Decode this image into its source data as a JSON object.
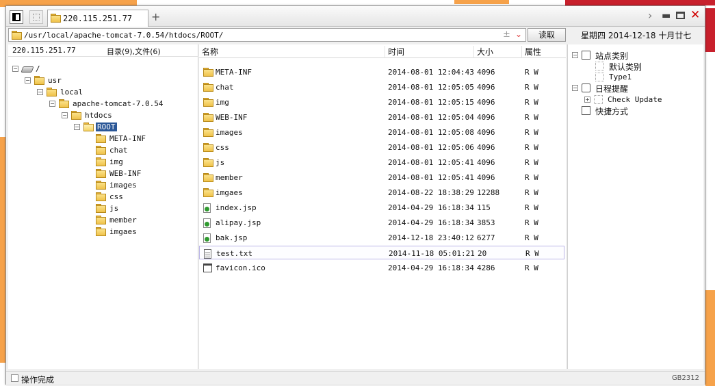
{
  "tab": {
    "host": "220.115.251.77"
  },
  "address": {
    "path": "/usr/local/apache-tomcat-7.0.54/htdocs/ROOT/",
    "read_label": "读取"
  },
  "date_bar": "星期四 2014-12-18 十月廿七",
  "left_panel": {
    "host": "220.115.251.77",
    "counts": "目录(9),文件(6)",
    "tree": [
      {
        "label": "/",
        "depth": 0,
        "expanded": true,
        "icon": "drive-icon"
      },
      {
        "label": "usr",
        "depth": 1,
        "expanded": true,
        "icon": "folder-icon"
      },
      {
        "label": "local",
        "depth": 2,
        "expanded": true,
        "icon": "folder-icon"
      },
      {
        "label": "apache-tomcat-7.0.54",
        "depth": 3,
        "expanded": true,
        "icon": "folder-icon"
      },
      {
        "label": "htdocs",
        "depth": 4,
        "expanded": true,
        "icon": "folder-icon"
      },
      {
        "label": "ROOT",
        "depth": 5,
        "expanded": true,
        "icon": "folder-open-icon",
        "selected": true
      },
      {
        "label": "META-INF",
        "depth": 6,
        "icon": "folder-icon"
      },
      {
        "label": "chat",
        "depth": 6,
        "icon": "folder-icon"
      },
      {
        "label": "img",
        "depth": 6,
        "icon": "folder-icon"
      },
      {
        "label": "WEB-INF",
        "depth": 6,
        "icon": "folder-icon"
      },
      {
        "label": "images",
        "depth": 6,
        "icon": "folder-icon"
      },
      {
        "label": "css",
        "depth": 6,
        "icon": "folder-icon"
      },
      {
        "label": "js",
        "depth": 6,
        "icon": "folder-icon"
      },
      {
        "label": "member",
        "depth": 6,
        "icon": "folder-icon"
      },
      {
        "label": "imgaes",
        "depth": 6,
        "icon": "folder-icon"
      }
    ]
  },
  "file_list": {
    "columns": {
      "name": "名称",
      "time": "时间",
      "size": "大小",
      "attr": "属性"
    },
    "rows": [
      {
        "name": "META-INF",
        "time": "2014-08-01 12:04:43",
        "size": "4096",
        "attr": "R W",
        "type": "folder"
      },
      {
        "name": "chat",
        "time": "2014-08-01 12:05:05",
        "size": "4096",
        "attr": "R W",
        "type": "folder"
      },
      {
        "name": "img",
        "time": "2014-08-01 12:05:15",
        "size": "4096",
        "attr": "R W",
        "type": "folder"
      },
      {
        "name": "WEB-INF",
        "time": "2014-08-01 12:05:04",
        "size": "4096",
        "attr": "R W",
        "type": "folder"
      },
      {
        "name": "images",
        "time": "2014-08-01 12:05:08",
        "size": "4096",
        "attr": "R W",
        "type": "folder"
      },
      {
        "name": "css",
        "time": "2014-08-01 12:05:06",
        "size": "4096",
        "attr": "R W",
        "type": "folder"
      },
      {
        "name": "js",
        "time": "2014-08-01 12:05:41",
        "size": "4096",
        "attr": "R W",
        "type": "folder"
      },
      {
        "name": "member",
        "time": "2014-08-01 12:05:41",
        "size": "4096",
        "attr": "R W",
        "type": "folder"
      },
      {
        "name": "imgaes",
        "time": "2014-08-22 18:38:29",
        "size": "12288",
        "attr": "R W",
        "type": "folder"
      },
      {
        "name": "index.jsp",
        "time": "2014-04-29 16:18:34",
        "size": "115",
        "attr": "R W",
        "type": "jsp"
      },
      {
        "name": "alipay.jsp",
        "time": "2014-04-29 16:18:34",
        "size": "3853",
        "attr": "R W",
        "type": "jsp"
      },
      {
        "name": "bak.jsp",
        "time": "2014-12-18 23:40:12",
        "size": "6277",
        "attr": "R W",
        "type": "jsp"
      },
      {
        "name": "test.txt",
        "time": "2014-11-18 05:01:21",
        "size": "20",
        "attr": "R W",
        "type": "txt",
        "selected": true
      },
      {
        "name": "favicon.ico",
        "time": "2014-04-29 16:18:34",
        "size": "4286",
        "attr": "R W",
        "type": "ico"
      }
    ]
  },
  "right_panel": {
    "site_category": "站点类别",
    "default_category": "默认类别",
    "type1": "Type1",
    "schedule": "日程提醒",
    "check_update": "Check Update",
    "shortcuts": "快捷方式"
  },
  "status": {
    "message": "操作完成",
    "encoding": "GB2312"
  }
}
